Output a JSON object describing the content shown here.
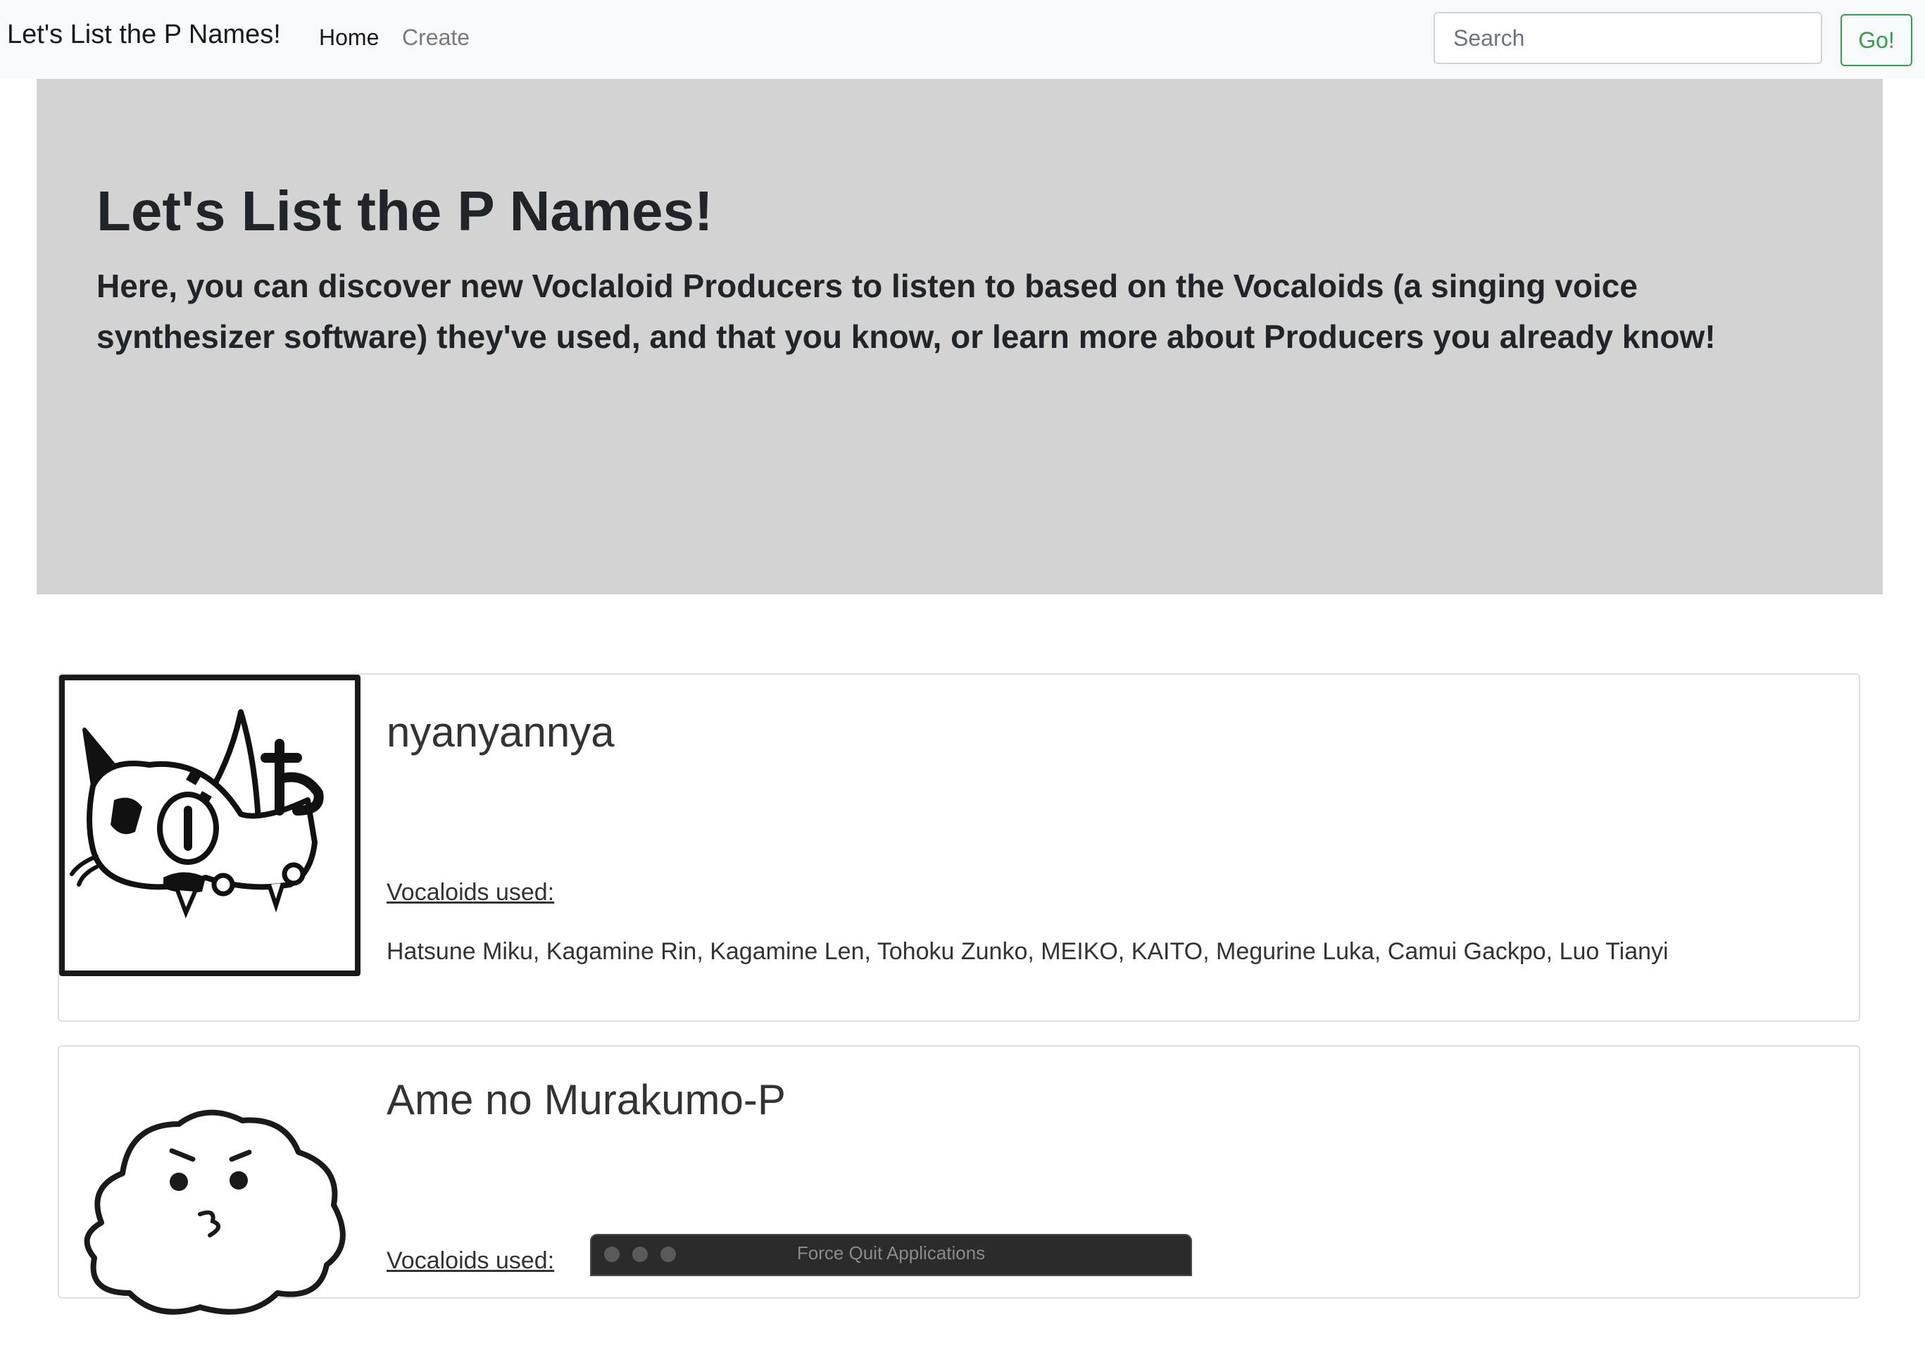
{
  "navbar": {
    "brand": "Let's List the P Names!",
    "links": [
      {
        "label": "Home",
        "active": true
      },
      {
        "label": "Create",
        "active": false
      }
    ],
    "search_placeholder": "Search",
    "go_label": "Go!"
  },
  "hero": {
    "title": "Let's List the P Names!",
    "subtitle": "Here, you can discover new Voclaloid Producers to listen to based on the Vocaloids (a singing voice synthesizer software) they've used, and that you know, or learn more about Producers you already know!"
  },
  "producers": [
    {
      "name": "nyanyannya",
      "avatar_icon": "cat-drawing-icon",
      "vocaloids_heading": "Vocaloids used:",
      "vocaloids": "Hatsune Miku, Kagamine Rin, Kagamine Len, Tohoku Zunko, MEIKO, KAITO, Megurine Luka, Camui Gackpo, Luo Tianyi"
    },
    {
      "name": "Ame no Murakumo-P",
      "avatar_icon": "cloud-face-icon",
      "vocaloids_heading": "Vocaloids used:",
      "vocaloids": ""
    }
  ],
  "overlay": {
    "force_quit_title": "Force Quit Applications"
  },
  "colors": {
    "navbar_bg": "#f8f9fa",
    "jumbotron_bg": "#d3d3d3",
    "go_button": "#28a745",
    "card_border": "#dfdfdf"
  }
}
